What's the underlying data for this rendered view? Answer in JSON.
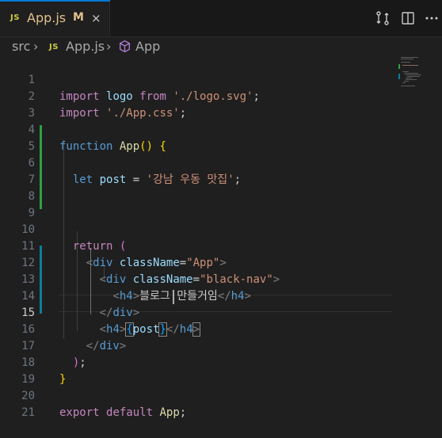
{
  "tab": {
    "badge": "JS",
    "name": "App.js",
    "status": "M",
    "close": "×"
  },
  "toolbar": {
    "compare_icon": "git-compare-icon",
    "split_icon": "split-editor-icon",
    "more_icon": "more-actions-icon"
  },
  "breadcrumb": {
    "folder": "src",
    "sep": "›",
    "file_badge": "JS",
    "file": "App.js",
    "symbol_icon": "cube-icon",
    "symbol": "App"
  },
  "editor": {
    "current_line": 15,
    "lines": [
      {
        "n": "1"
      },
      {
        "n": "2"
      },
      {
        "n": "3"
      },
      {
        "n": "4"
      },
      {
        "n": "5"
      },
      {
        "n": "6"
      },
      {
        "n": "7"
      },
      {
        "n": "8"
      },
      {
        "n": "9"
      },
      {
        "n": "10"
      },
      {
        "n": "11"
      },
      {
        "n": "12"
      },
      {
        "n": "13"
      },
      {
        "n": "14"
      },
      {
        "n": "15"
      },
      {
        "n": "16"
      },
      {
        "n": "17"
      },
      {
        "n": "18"
      },
      {
        "n": "19"
      },
      {
        "n": "20"
      },
      {
        "n": "21"
      }
    ],
    "t": {
      "import": "import",
      "logo": "logo",
      "from": "from",
      "logo_path": "'./logo.svg'",
      "semi": ";",
      "css_path": "'./App.css'",
      "function": "function",
      "app_name": "App",
      "paren_open": "(",
      "paren_close": ")",
      "brace_open": "{",
      "brace_close": "}",
      "let": "let",
      "post": "post",
      "eq": "=",
      "post_value": "'강남 우동 맛집'",
      "return": "return",
      "lt": "<",
      "gt": ">",
      "lt_slash": "</",
      "div": "div",
      "h4": "h4",
      "className": "className",
      "attr_eq": "=",
      "app_class": "\"App\"",
      "nav_class": "\"black-nav\"",
      "h4_text": "블로그 만들거임",
      "export": "export",
      "default": "default"
    }
  }
}
